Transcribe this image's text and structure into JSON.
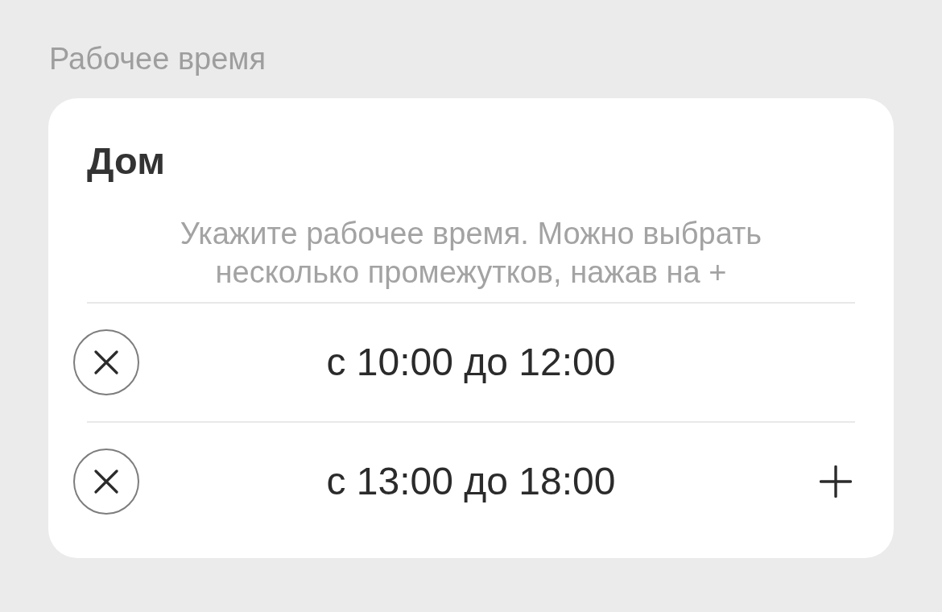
{
  "section_title": "Рабочее время",
  "card": {
    "title": "Дом",
    "hint": "Укажите рабочее время. Можно выбрать несколько промежутков, нажав на +",
    "intervals": [
      {
        "label": "с 10:00 до 12:00"
      },
      {
        "label": "с 13:00 до 18:00"
      }
    ]
  }
}
